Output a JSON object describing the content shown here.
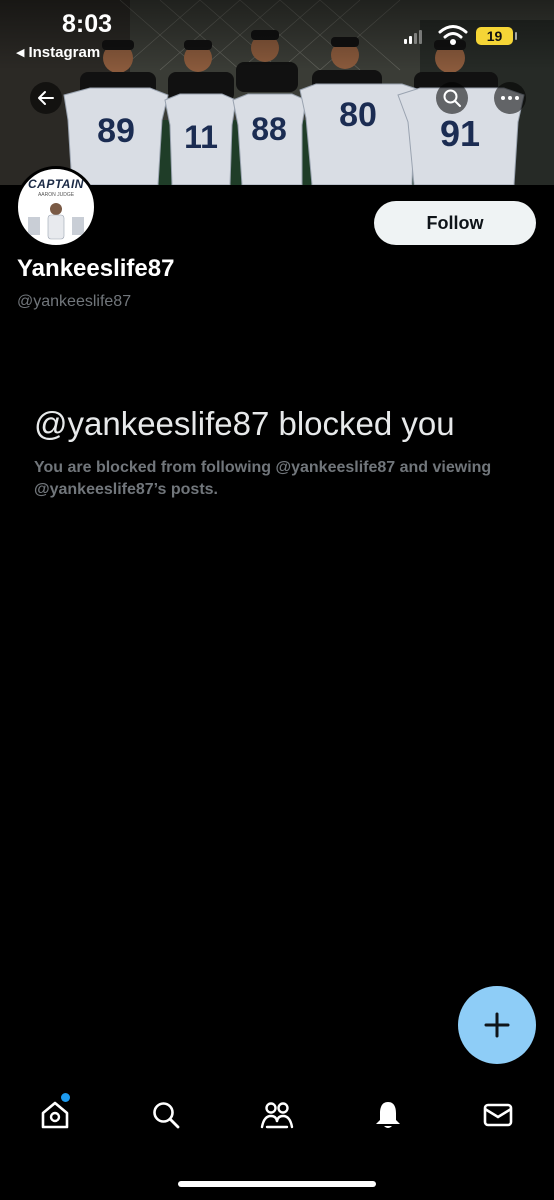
{
  "status_bar": {
    "time": "8:03",
    "back_app": "Instagram",
    "battery": "19",
    "colors": {
      "battery": "#f5d536"
    }
  },
  "banner": {
    "jerseys": [
      "89",
      "11",
      "88",
      "80",
      "91"
    ]
  },
  "profile": {
    "avatar_text": "CAPTAIN",
    "avatar_subtext": "AARON JUDGE",
    "display_name": "Yankeeslife87",
    "handle": "@yankeeslife87",
    "follow_label": "Follow"
  },
  "blocked": {
    "title": "@yankeeslife87 blocked you",
    "description": "You are blocked from following @yankeeslife87 and viewing @yankeeslife87’s posts."
  },
  "icons": {
    "back": "back-arrow-icon",
    "search": "search-icon",
    "more": "more-icon",
    "compose": "plus-icon",
    "nav": [
      "home-icon",
      "search-icon",
      "communities-icon",
      "bell-icon",
      "mail-icon"
    ]
  },
  "colors": {
    "background": "#000000",
    "accent": "#1d9bf0",
    "fab": "#8ecdf7",
    "secondary_text": "#71767b",
    "follow_button": "#eff3f4"
  }
}
